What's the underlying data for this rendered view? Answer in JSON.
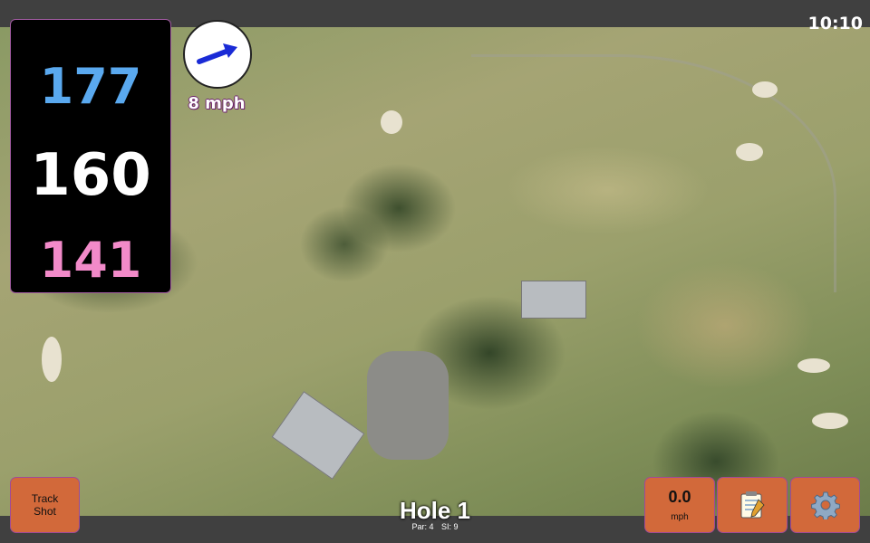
{
  "status": {
    "time": "10:10"
  },
  "distances": {
    "back": "177",
    "middle": "160",
    "front": "141"
  },
  "wind": {
    "speed": "8 mph",
    "direction_icon": "wind-arrow-icon"
  },
  "hole": {
    "title": "Hole 1",
    "par": "Par: 4",
    "stroke_index": "SI: 9"
  },
  "buttons": {
    "track_shot_line1": "Track",
    "track_shot_line2": "Shot",
    "speed_value": "0.0",
    "speed_unit": "mph",
    "notes_icon": "notepad-icon",
    "settings_icon": "gear-icon"
  },
  "colors": {
    "back": "#5aa9ef",
    "middle": "#ffffff",
    "front": "#f28ac9",
    "button": "#d2693a",
    "arrow": "#1a2bd6"
  }
}
